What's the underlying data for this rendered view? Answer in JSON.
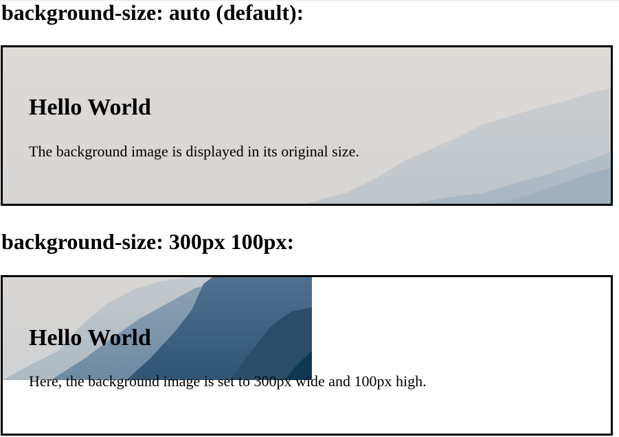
{
  "sections": [
    {
      "heading": "background-size: auto (default):",
      "title": "Hello World",
      "text": "The background image is displayed in its original size."
    },
    {
      "heading": "background-size: 300px 100px:",
      "title": "Hello World",
      "text": "Here, the background image is set to 300px wide and 100px high."
    }
  ],
  "colors": {
    "border": "#000000",
    "sky": "#dcd9d6",
    "mountain_light": "#b8c2c9",
    "mountain_dark": "#0f3c5a"
  }
}
